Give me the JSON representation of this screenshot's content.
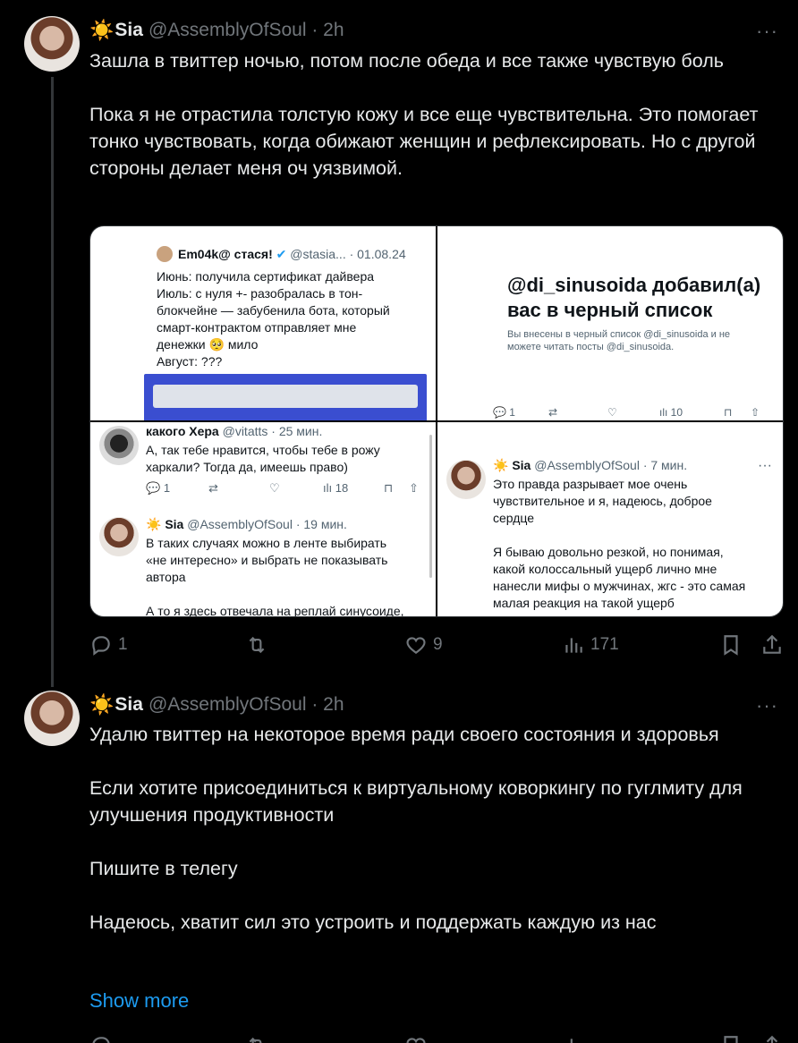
{
  "tweet1": {
    "sun": "☀️",
    "name": "Sia",
    "handle": "@AssemblyOfSoul · 2h",
    "more": "···",
    "text": "Зашла в твиттер ночью, потом после обеда и все также чувствую боль\n\nПока я не отрастила толстую кожу и все еще чувствительна. Это помогает тонко чувствовать, когда обижают женщин и рефлексировать. Но с другой стороны делает меня оч уязвимой.",
    "replies": "1",
    "retweets": "",
    "likes": "9",
    "views": "171"
  },
  "media": {
    "q1": {
      "name": "Em04k@ стася!",
      "handle": "@stasia... · 01.08.24",
      "text": "Июнь: получила сертификат дайвера\nИюль: с нуля +- разобралась в тон-\nблокчейне — забубенила бота, который\nсмарт-контрактом отправляет мне\nденежки 🥺 мило\nАвгуст: ???"
    },
    "q2": {
      "title": "@di_sinusoida добавил(а)\nвас в черный список",
      "subtitle": "Вы внесены в черный список @di_sinusoida и не\nможете читать посты @di_sinusoida.",
      "replies": "1",
      "views": "10"
    },
    "q3": {
      "top_name": "какого Хера",
      "top_handle": "@vitatts · 25 мин.",
      "top_text": "А, так тебе нравится, чтобы тебе в рожу\nхаркали? Тогда да, имеешь право)",
      "top_replies": "1",
      "top_views": "18",
      "name": "Sia",
      "handle": "@AssemblyOfSoul · 19 мин.",
      "text": "В таких случаях можно в ленте выбирать\n«не интересно» и выбрать не показывать\nавтора\n\nА то я здесь отвечала на реплай синусоиде,"
    },
    "q4": {
      "name": "Sia",
      "handle": "@AssemblyOfSoul · 7 мин.",
      "text": "Это правда разрывает мое очень\nчувствительное и я, надеюсь, доброе\nсердце\n\nЯ бываю довольно резкой, но понимая,\nкакой колоссальный ущерб лично мне\nнанесли мифы о мужчинах, жгс - это самая\nмалая реакция на такой ущерб"
    }
  },
  "tweet2": {
    "sun": "☀️",
    "name": "Sia",
    "handle": "@AssemblyOfSoul · 2h",
    "more": "···",
    "text": "Удалю твиттер на некоторое время ради своего состояния и здоровья\n\nЕсли хотите присоединиться к виртуальному коворкингу по гуглмиту для улучшения продуктивности\n\nПишите в телегу\n\nНадеюсь, хватит сил это устроить и поддержать каждую из нас",
    "show_more": "Show more"
  }
}
